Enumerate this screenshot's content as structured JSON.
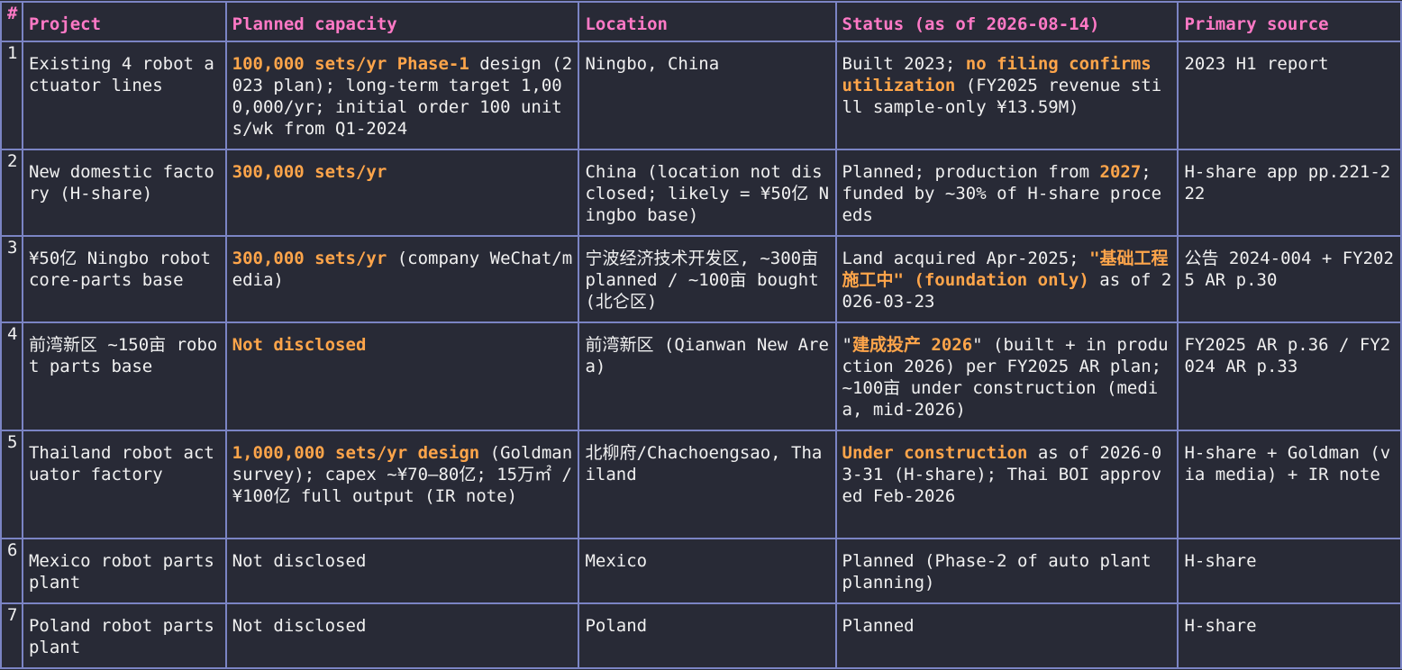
{
  "colors": {
    "background": "#282a36",
    "border": "#7b84c4",
    "header_text": "#ff79c6",
    "body_text": "#f0f0f0",
    "highlight": "#ffa54a"
  },
  "table": {
    "headers": [
      "#",
      "Project",
      "Planned capacity",
      "Location",
      "Status (as of 2026-08-14)",
      "Primary source"
    ],
    "rows": [
      {
        "num": "1",
        "project": "Existing 4 robot actuator lines",
        "capacity": [
          {
            "t": "100,000 sets/yr Phase-1",
            "b": true
          },
          {
            "t": " design (2023 plan); long-term target 1,000,000/yr; initial order 100 units/wk from Q1-2024",
            "b": false
          }
        ],
        "location": [
          {
            "t": "Ningbo, China",
            "b": false
          }
        ],
        "status": [
          {
            "t": "Built 2023; ",
            "b": false
          },
          {
            "t": "no filing confirms utilization",
            "b": true
          },
          {
            "t": " (FY2025 revenue still sample-only ¥13.59M)",
            "b": false
          }
        ],
        "source": "2023 H1 report"
      },
      {
        "num": "2",
        "project": "New domestic factory (H-share)",
        "capacity": [
          {
            "t": "300,000 sets/yr",
            "b": true
          }
        ],
        "location": [
          {
            "t": "China (location not disclosed; likely = ¥50亿 Ningbo base)",
            "b": false
          }
        ],
        "status": [
          {
            "t": "Planned; production from ",
            "b": false
          },
          {
            "t": "2027",
            "b": true
          },
          {
            "t": "; funded by ~30% of H-share proceeds",
            "b": false
          }
        ],
        "source": "H-share app pp.221-222"
      },
      {
        "num": "3",
        "project": "¥50亿 Ningbo robot core-parts base",
        "capacity": [
          {
            "t": "300,000 sets/yr",
            "b": true
          },
          {
            "t": " (company WeChat/media)",
            "b": false
          }
        ],
        "location": [
          {
            "t": "宁波经济技术开发区, ~300亩 planned / ~100亩 bought (北仑区)",
            "b": false
          }
        ],
        "status": [
          {
            "t": "Land acquired Apr-2025; ",
            "b": false
          },
          {
            "t": "\"基础工程施工中\" (foundation only)",
            "b": true
          },
          {
            "t": " as of 2026-03-23",
            "b": false
          }
        ],
        "source": "公告 2024-004 + FY2025 AR p.30"
      },
      {
        "num": "4",
        "project": "前湾新区 ~150亩 robot parts base",
        "capacity": [
          {
            "t": "Not disclosed",
            "b": true
          }
        ],
        "location": [
          {
            "t": "前湾新区 (Qianwan New Area)",
            "b": false
          }
        ],
        "status": [
          {
            "t": "\"",
            "b": false
          },
          {
            "t": "建成投产 2026",
            "b": true
          },
          {
            "t": "\" (built + in production 2026) per FY2025 AR plan; ~100亩 under construction (media, mid-2026)",
            "b": false
          }
        ],
        "source": "FY2025 AR p.36 / FY2024 AR p.33"
      },
      {
        "num": "5",
        "project": "Thailand robot actuator factory",
        "capacity": [
          {
            "t": "1,000,000 sets/yr design",
            "b": true
          },
          {
            "t": " (Goldman survey); capex ~¥70–80亿; 15万㎡ / ¥100亿 full output (IR note)",
            "b": false
          }
        ],
        "location": [
          {
            "t": "北柳府/Chachoengsao, Thailand",
            "b": false
          }
        ],
        "status": [
          {
            "t": "Under construction",
            "b": true
          },
          {
            "t": " as of 2026-03-31 (H-share); Thai BOI approved Feb-2026",
            "b": false
          }
        ],
        "source": "H-share + Goldman (via media) + IR note"
      },
      {
        "num": "6",
        "project": "Mexico robot parts plant",
        "capacity": [
          {
            "t": "Not disclosed",
            "b": false
          }
        ],
        "location": [
          {
            "t": "Mexico",
            "b": false
          }
        ],
        "status": [
          {
            "t": "Planned (Phase-2 of auto plant planning)",
            "b": false
          }
        ],
        "source": "H-share"
      },
      {
        "num": "7",
        "project": "Poland robot parts plant",
        "capacity": [
          {
            "t": "Not disclosed",
            "b": false
          }
        ],
        "location": [
          {
            "t": "Poland",
            "b": false
          }
        ],
        "status": [
          {
            "t": "Planned",
            "b": false
          }
        ],
        "source": "H-share"
      }
    ]
  }
}
